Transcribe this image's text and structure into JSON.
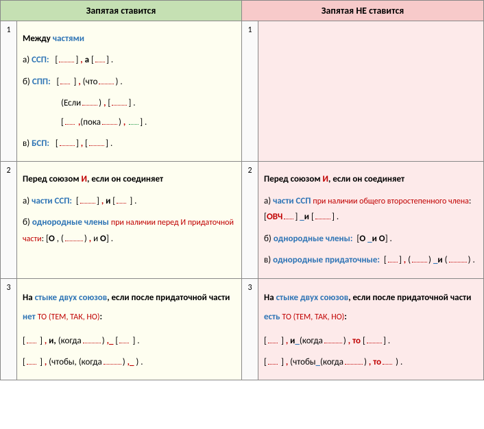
{
  "headers": {
    "left": "Запятая ставится",
    "right": "Запятая НЕ ставится"
  },
  "rows": [
    {
      "num": "1",
      "left": {
        "title_pre": "Между ",
        "title_blue": "частями",
        "a_label": "а) ",
        "a_type": "ССП:",
        "b_label": "б) ",
        "b_type": "СПП:",
        "b_word1": "(что",
        "b_word2": "(Если",
        "b_word3": "(пока",
        "c_label": "в) ",
        "c_type": "БСП:",
        "a_conj": "а"
      },
      "right": {}
    },
    {
      "num": "2",
      "left": {
        "title_pre": "Перед союзом ",
        "title_conj": "И",
        "title_post": ", если он соединяет",
        "a_label": "а) ",
        "a_blue": "части ССП:",
        "a_conj": "и",
        "b_label": "б)  ",
        "b_blue": "однородные члены ",
        "b_red": "при наличии  перед  И  придаточной части",
        "b_colon": ": ",
        "b_o1": "О",
        "b_o2": "О"
      },
      "right": {
        "title_pre": "Перед союзом ",
        "title_conj": "И",
        "title_post": ", если он соединяет",
        "a_label": "а) ",
        "a_blue": "части ССП ",
        "a_red": "при наличии общего второстепенного члена",
        "a_colon": ":  ",
        "a_ovch": "ОВЧ",
        "a_conj": "и",
        "b_label": "б) ",
        "b_blue": "однородные члены:",
        "b_o1": "О",
        "b_conj": "и",
        "b_o2": "О",
        "c_label": "в) ",
        "c_blue": "однородные придаточные:",
        "c_conj": "и"
      }
    },
    {
      "num": "3",
      "left": {
        "title_pre": "На ",
        "title_blue": "стыке двух союзов",
        "title_post": ", если после придаточной части ",
        "net": "нет ",
        "words": "ТО (ТЕМ,  ТАК,  НО)",
        "colon": ":",
        "line1_and": "и,",
        "line1_word": "(когда",
        "line2_word1": "(чтобы,",
        "line2_word2": "(когда"
      },
      "right": {
        "title_pre": "На ",
        "title_blue": "стыке двух союзов",
        "title_post": ", если после придаточной части ",
        "est": "есть ",
        "words": "ТО (ТЕМ,  ТАК,  НО)",
        "colon": ":",
        "line1_and": "и",
        "line1_word": "(когда",
        "line1_to": "то",
        "line2_word1": "(чтобы",
        "line2_word2": "(когда",
        "line2_to": "то"
      }
    }
  ]
}
